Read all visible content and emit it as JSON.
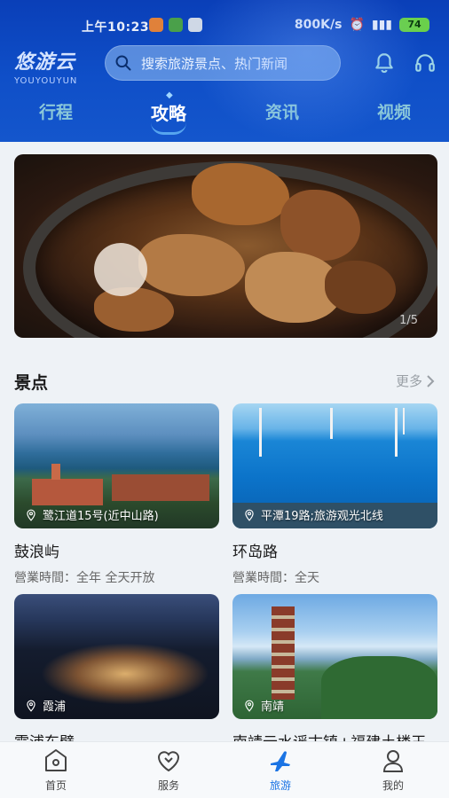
{
  "status_bar": {
    "time": "上午10:23",
    "speed": "800K/s",
    "battery": "74"
  },
  "header": {
    "logo_main": "悠游云",
    "logo_sub": "YOUYOUYUN",
    "search_placeholder": "搜索旅游景点、热门新闻",
    "tabs": [
      {
        "label": "行程",
        "active": false
      },
      {
        "label": "攻略",
        "active": true
      },
      {
        "label": "资讯",
        "active": false
      },
      {
        "label": "视频",
        "active": false
      }
    ]
  },
  "banner": {
    "pager": "1/5"
  },
  "attractions": {
    "title": "景点",
    "more_label": "更多",
    "cards": [
      {
        "name": "鼓浪屿",
        "location": "鹭江道15号(近中山路)",
        "hours": "營業時間：全年 全天开放"
      },
      {
        "name": "环岛路",
        "location": "平潭19路;旅游观光北线",
        "hours": "營業時間：全天"
      },
      {
        "name": "霞浦东壁",
        "location": "霞浦",
        "hours": ""
      },
      {
        "name": "南靖云水谣古镇+福建土楼王…",
        "location": "南靖",
        "hours": ""
      }
    ]
  },
  "bottom_nav": [
    {
      "label": "首页",
      "icon": "home-icon",
      "active": false
    },
    {
      "label": "服务",
      "icon": "service-heart-icon",
      "active": false
    },
    {
      "label": "旅游",
      "icon": "airplane-icon",
      "active": true
    },
    {
      "label": "我的",
      "icon": "profile-icon",
      "active": false
    }
  ],
  "colors": {
    "header_blue": "#0f4fc8",
    "accent": "#1b74e4",
    "tab_inactive": "#a0dcdc"
  }
}
